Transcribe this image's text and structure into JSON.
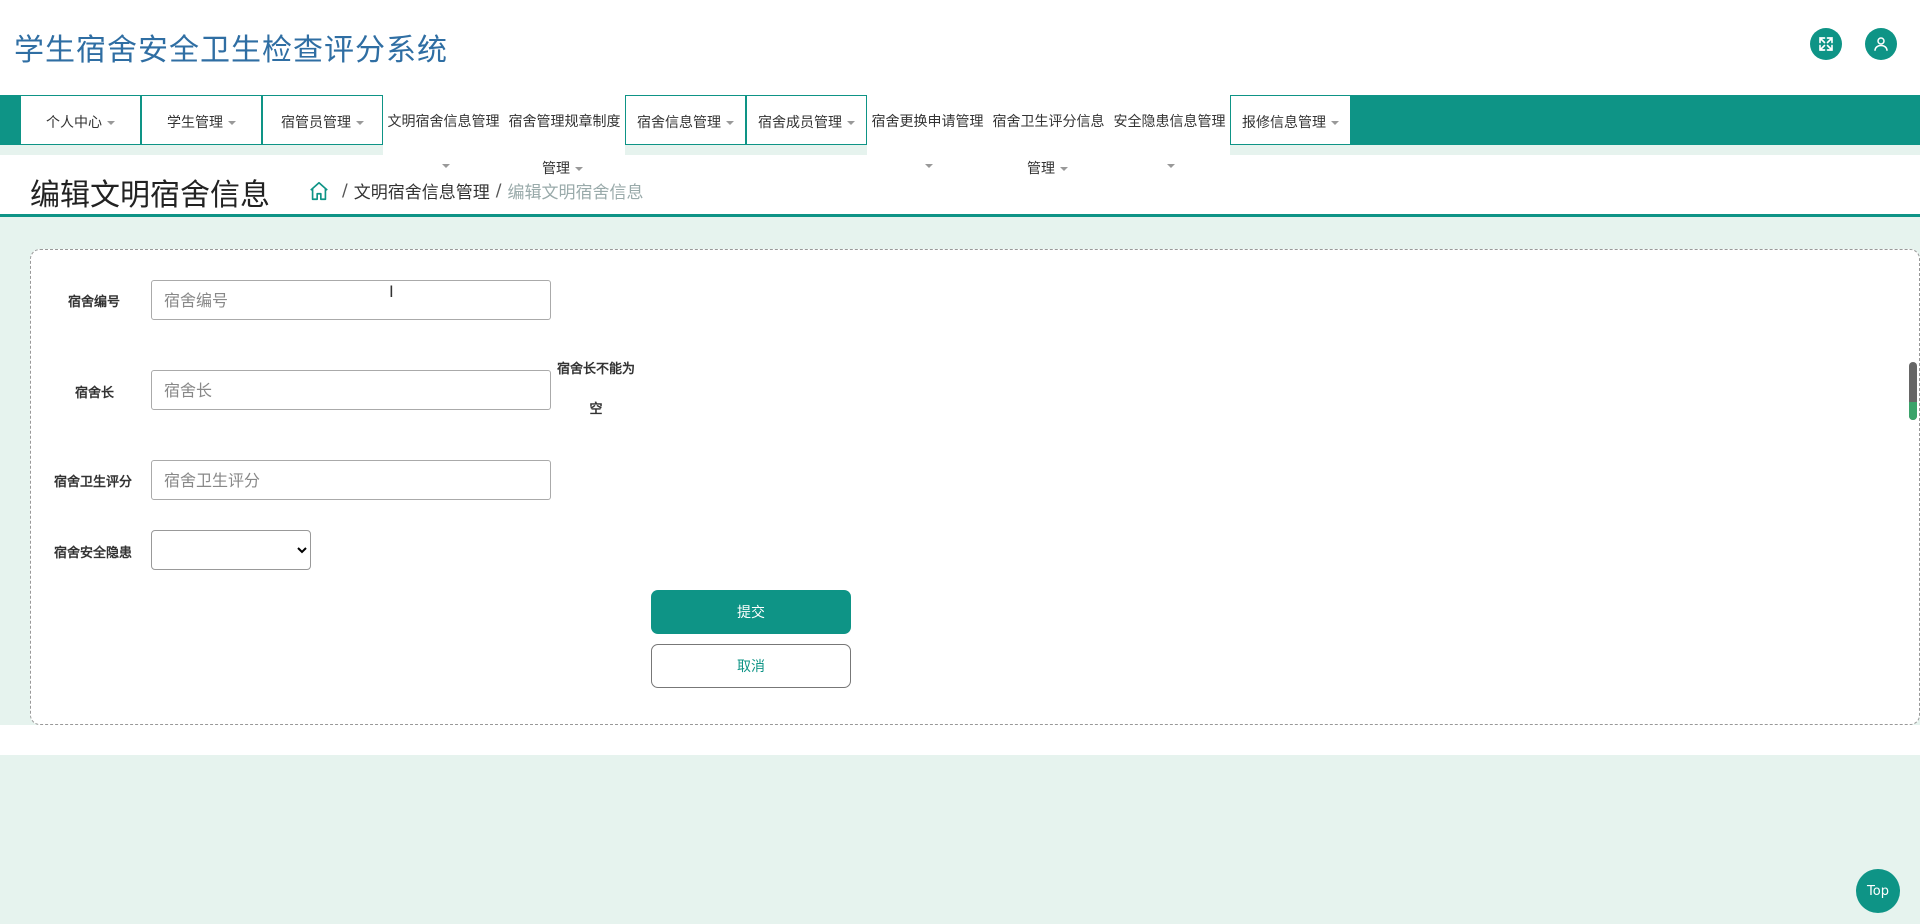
{
  "header": {
    "title": "学生宿舍安全卫生检查评分系统",
    "fullscreen_icon": "fullscreen-icon",
    "user_icon": "user-icon"
  },
  "nav": {
    "items": [
      {
        "label": "个人中心",
        "dropdown": true
      },
      {
        "label": "学生管理",
        "dropdown": true
      },
      {
        "label": "宿管员管理",
        "dropdown": true
      },
      {
        "label": "文明宿舍信息管理",
        "dropdown": true
      },
      {
        "label": "宿舍管理规章制度",
        "sub": "管理",
        "dropdown": true
      },
      {
        "label": "宿舍信息管理",
        "dropdown": true
      },
      {
        "label": "宿舍成员管理",
        "dropdown": true
      },
      {
        "label": "宿舍更换申请管理",
        "dropdown": true
      },
      {
        "label": "宿舍卫生评分信息",
        "sub": "管理",
        "dropdown": true
      },
      {
        "label": "安全隐患信息管理",
        "dropdown": true
      },
      {
        "label": "报修信息管理",
        "dropdown": true
      }
    ]
  },
  "page": {
    "title": "编辑文明宿舍信息",
    "breadcrumb": {
      "home_icon": "home-icon",
      "sep": "/",
      "level1": "文明宿舍信息管理",
      "level2": "编辑文明宿舍信息"
    }
  },
  "form": {
    "fields": {
      "dorm_no": {
        "label": "宿舍编号",
        "placeholder": "宿舍编号",
        "value": ""
      },
      "dorm_leader": {
        "label": "宿舍长",
        "placeholder": "宿舍长",
        "value": "",
        "error": "宿舍长不能为空"
      },
      "hygiene_score": {
        "label": "宿舍卫生评分",
        "placeholder": "宿舍卫生评分",
        "value": ""
      },
      "safety_hazard": {
        "label": "宿舍安全隐患",
        "selected": ""
      }
    },
    "submit_label": "提交",
    "cancel_label": "取消"
  },
  "top_button": "Top",
  "colors": {
    "accent": "#0e9486",
    "title_blue": "#2f6ea3",
    "background": "#e6f3ee"
  }
}
